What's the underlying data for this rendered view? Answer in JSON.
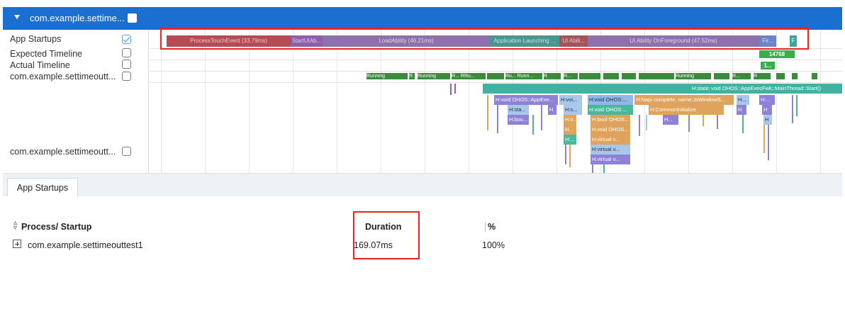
{
  "header": {
    "title": "com.example.settime..."
  },
  "rows": {
    "app_startups": "App Startups",
    "expected": "Expected Timeline",
    "actual": "Actual Timeline",
    "process": "com.example.settimeoutt...",
    "thread": "com.example.settimeoutt..."
  },
  "startup_segments": [
    {
      "label": "ProcessTouchEvent (33.79ms)",
      "color": "#b64b55"
    },
    {
      "label": "StartUIAb...",
      "color": "#8c5fa8"
    },
    {
      "label": "LoadAbility (46.21ms)",
      "color": "#8d71ad"
    },
    {
      "label": "Application Launching ...",
      "color": "#4b958f"
    },
    {
      "label": "UI Abili...",
      "color": "#a2545a"
    },
    {
      "label": "UI Ability OnForeground (47.52ms)",
      "color": "#8d71ad"
    },
    {
      "label": "Fir...",
      "color": "#6a86c8"
    },
    {
      "label": "F",
      "color": "#43a29a"
    }
  ],
  "badges": {
    "expected": "14768",
    "actual": "1..."
  },
  "running_labels": [
    "Running",
    "R",
    "Running",
    "R... R",
    "R",
    "Ru...",
    "Ru... Runn...",
    "R",
    "R...",
    "Running",
    "R...",
    "R"
  ],
  "flame": {
    "main": "H:static void OHOS::AppExecFwk::MainThread::Start()",
    "level1": [
      "H:void OHOS::AppExe...",
      "H:voi...",
      "H:void OHOS:...",
      "H:Napi complete, name:JsWindowS...",
      "H...",
      "H:..."
    ],
    "level2": [
      "H:sta...",
      "H",
      "H:s...",
      "H:void OHOS:...",
      "H:CommonInitialize",
      "H",
      "H"
    ],
    "level3": [
      "H:boo...",
      "H:v...",
      "H:bool OHOS...",
      "H...",
      "H"
    ],
    "level4": [
      "H...",
      "H:void OHOS...",
      "H:virtual v...",
      "H:...",
      "H:virtual v...",
      "H:virtual v..."
    ]
  },
  "bottom": {
    "tab": "App Startups",
    "col_process": "Process/ Startup",
    "col_duration": "Duration",
    "col_percent": "%",
    "row": {
      "process": "com.example.settimeouttest1",
      "duration": "169.07ms",
      "percent": "100%"
    }
  }
}
